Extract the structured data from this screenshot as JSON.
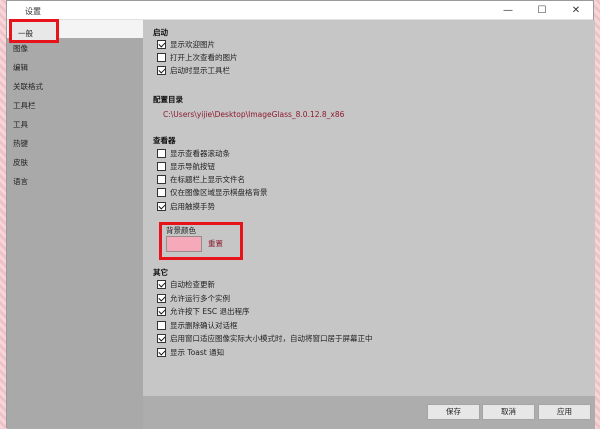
{
  "window": {
    "title": "设置"
  },
  "titlebar": {
    "minimize": "—",
    "maximize": "☐",
    "close": "✕"
  },
  "sidebar": {
    "items": [
      {
        "label": "一般"
      },
      {
        "label": "图像"
      },
      {
        "label": "编辑"
      },
      {
        "label": "关联格式"
      },
      {
        "label": "工具栏"
      },
      {
        "label": "工具"
      },
      {
        "label": "热键"
      },
      {
        "label": "皮肤"
      },
      {
        "label": "语言"
      }
    ]
  },
  "startup": {
    "title": "启动",
    "options": [
      {
        "label": "显示欢迎图片",
        "checked": true
      },
      {
        "label": "打开上次查看的图片",
        "checked": false
      },
      {
        "label": "启动时显示工具栏",
        "checked": true
      }
    ]
  },
  "config": {
    "title": "配置目录",
    "path": "C:\\Users\\yijie\\Desktop\\ImageGlass_8.0.12.8_x86"
  },
  "viewer": {
    "title": "查看器",
    "options": [
      {
        "label": "显示查看器滚动条",
        "checked": false
      },
      {
        "label": "显示导航按钮",
        "checked": false
      },
      {
        "label": "在标题栏上显示文件名",
        "checked": false
      },
      {
        "label": "仅在图像区域显示棋盘格背景",
        "checked": false
      },
      {
        "label": "启用触摸手势",
        "checked": true
      }
    ]
  },
  "background": {
    "label": "背景颜色",
    "color": "#f6a9b8",
    "reset": "重置"
  },
  "other": {
    "title": "其它",
    "options": [
      {
        "label": "自动检查更新",
        "checked": true
      },
      {
        "label": "允许运行多个实例",
        "checked": true
      },
      {
        "label": "允许按下 ESC 退出程序",
        "checked": true
      },
      {
        "label": "显示删除确认对话框",
        "checked": false
      },
      {
        "label": "启用窗口适应图像实际大小模式时，自动将窗口居于屏幕正中",
        "checked": true
      },
      {
        "label": "显示 Toast 通知",
        "checked": true
      }
    ]
  },
  "footer": {
    "save": "保存",
    "cancel": "取消",
    "apply": "应用"
  },
  "colors": {
    "highlight": "#e6131b",
    "link": "#8b1b2f"
  }
}
